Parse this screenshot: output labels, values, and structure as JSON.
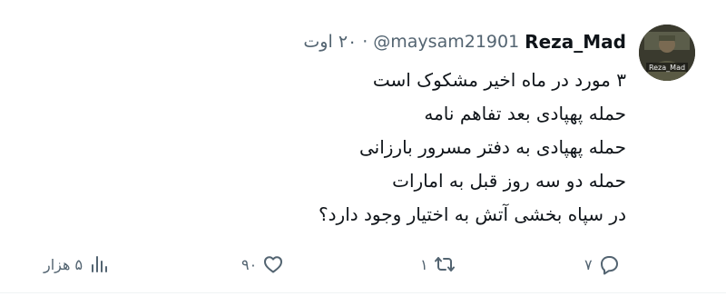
{
  "author": {
    "name": "Reza_Mad",
    "handle": "@maysam21901",
    "separator": "·",
    "date": "۲۰ اوت",
    "avatar_caption": "Reza_Mad"
  },
  "tweet": {
    "lines": [
      "۳ مورد در ماه اخیر مشکوک است",
      "حمله پهپادی بعد تفاهم نامه",
      "حمله پهپادی به دفتر مسرور بارزانی",
      "حمله دو سه روز قبل به امارات",
      "در سپاه بخشی آتش به اختیار وجود دارد؟"
    ]
  },
  "actions": {
    "reply": {
      "icon": "reply-icon",
      "count": "۷"
    },
    "retweet": {
      "icon": "retweet-icon",
      "count": "۱"
    },
    "like": {
      "icon": "heart-icon",
      "count": "۹۰"
    },
    "views": {
      "icon": "views-icon",
      "count": "۵ هزار"
    }
  },
  "colors": {
    "text": "#0f1419",
    "secondary": "#536471",
    "divider": "#eff3f4"
  }
}
